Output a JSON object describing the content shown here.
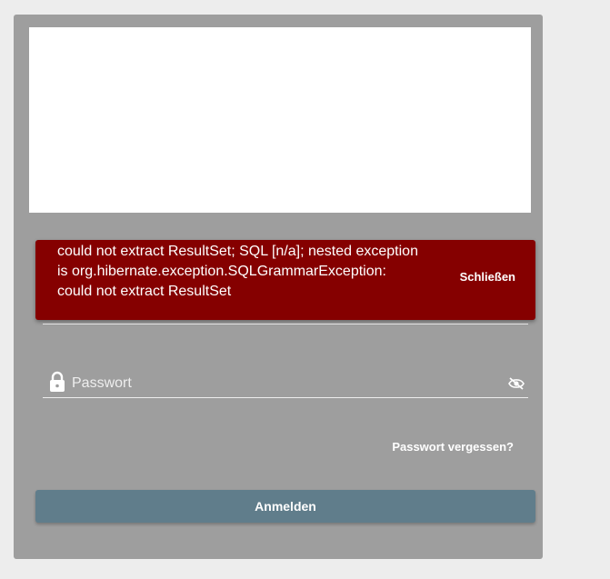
{
  "login": {
    "password_placeholder": "Passwort",
    "forgot_password_label": "Passwort vergessen?",
    "login_button_label": "Anmelden"
  },
  "error": {
    "message": "could not extract ResultSet; SQL [n/a]; nested exception is org.hibernate.exception.SQLGrammarException: could not extract ResultSet",
    "close_label": "Schließen"
  },
  "colors": {
    "page_background": "#ededed",
    "card_background": "#9e9e9e",
    "error_background": "#850000",
    "button_background": "#607d8b"
  },
  "icons": {
    "password": "lock-icon",
    "visibility_toggle": "eye-off-icon"
  }
}
